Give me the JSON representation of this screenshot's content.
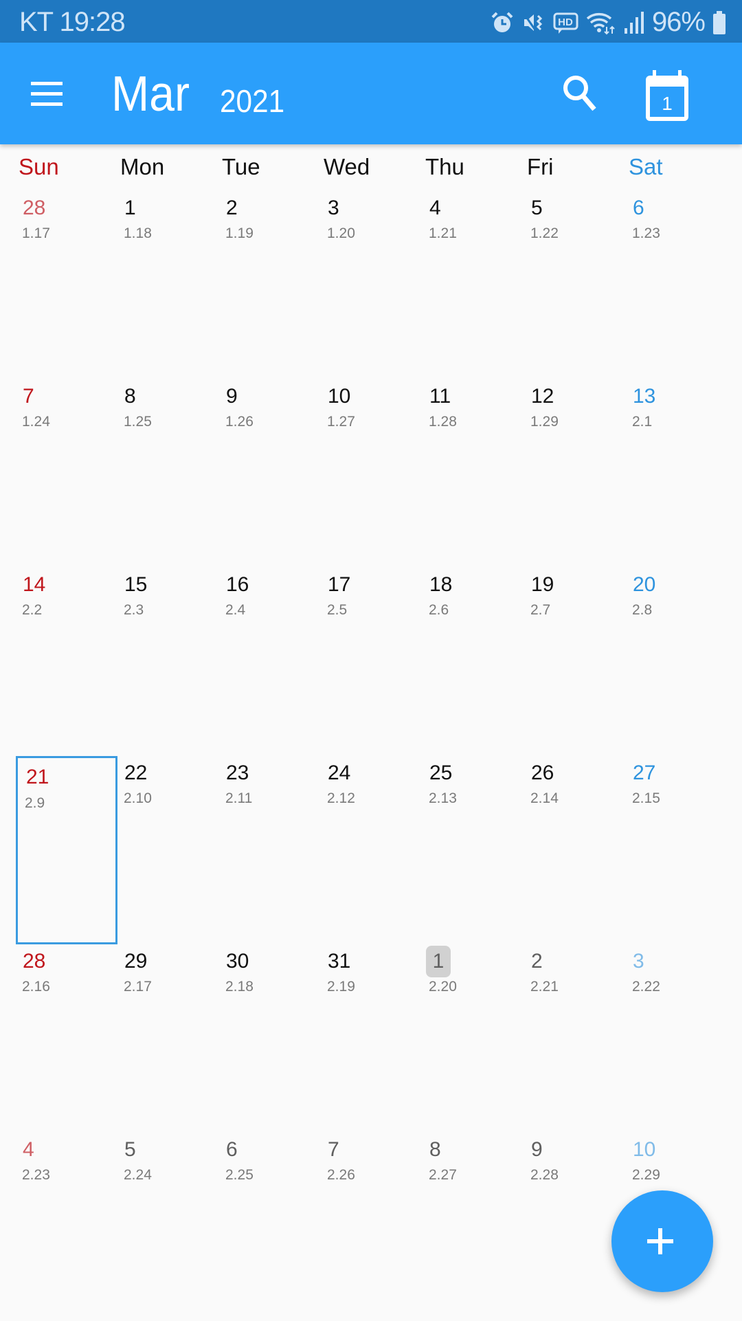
{
  "status_bar": {
    "carrier_time": "KT 19:28",
    "battery_text": "96%",
    "icons": [
      "alarm-icon",
      "vibrate-mute-icon",
      "hd-voice-icon",
      "wifi-icon",
      "signal-icon",
      "battery-icon"
    ]
  },
  "app_bar": {
    "month": "Mar",
    "year": "2021",
    "today_icon_day": "1",
    "icons": [
      "menu-icon",
      "search-icon",
      "calendar-today-icon"
    ]
  },
  "colors": {
    "app_bar": "#2b9ffb",
    "status_bar": "#1f78c1",
    "sunday": "#c0161c",
    "saturday": "#2e93de",
    "selected_border": "#3a9be0",
    "today_badge": "#cbcbcb"
  },
  "weekdays": [
    "Sun",
    "Mon",
    "Tue",
    "Wed",
    "Thu",
    "Fri",
    "Sat"
  ],
  "weeks": [
    [
      {
        "day": "28",
        "lunar": "1.17",
        "other": true
      },
      {
        "day": "1",
        "lunar": "1.18"
      },
      {
        "day": "2",
        "lunar": "1.19"
      },
      {
        "day": "3",
        "lunar": "1.20"
      },
      {
        "day": "4",
        "lunar": "1.21"
      },
      {
        "day": "5",
        "lunar": "1.22"
      },
      {
        "day": "6",
        "lunar": "1.23"
      }
    ],
    [
      {
        "day": "7",
        "lunar": "1.24"
      },
      {
        "day": "8",
        "lunar": "1.25"
      },
      {
        "day": "9",
        "lunar": "1.26"
      },
      {
        "day": "10",
        "lunar": "1.27"
      },
      {
        "day": "11",
        "lunar": "1.28"
      },
      {
        "day": "12",
        "lunar": "1.29"
      },
      {
        "day": "13",
        "lunar": "2.1"
      }
    ],
    [
      {
        "day": "14",
        "lunar": "2.2"
      },
      {
        "day": "15",
        "lunar": "2.3"
      },
      {
        "day": "16",
        "lunar": "2.4"
      },
      {
        "day": "17",
        "lunar": "2.5"
      },
      {
        "day": "18",
        "lunar": "2.6"
      },
      {
        "day": "19",
        "lunar": "2.7"
      },
      {
        "day": "20",
        "lunar": "2.8"
      }
    ],
    [
      {
        "day": "21",
        "lunar": "2.9",
        "selected": true
      },
      {
        "day": "22",
        "lunar": "2.10"
      },
      {
        "day": "23",
        "lunar": "2.11"
      },
      {
        "day": "24",
        "lunar": "2.12"
      },
      {
        "day": "25",
        "lunar": "2.13"
      },
      {
        "day": "26",
        "lunar": "2.14"
      },
      {
        "day": "27",
        "lunar": "2.15"
      }
    ],
    [
      {
        "day": "28",
        "lunar": "2.16"
      },
      {
        "day": "29",
        "lunar": "2.17"
      },
      {
        "day": "30",
        "lunar": "2.18"
      },
      {
        "day": "31",
        "lunar": "2.19"
      },
      {
        "day": "1",
        "lunar": "2.20",
        "other": true,
        "today": true
      },
      {
        "day": "2",
        "lunar": "2.21",
        "other": true
      },
      {
        "day": "3",
        "lunar": "2.22",
        "other": true
      }
    ],
    [
      {
        "day": "4",
        "lunar": "2.23",
        "other": true
      },
      {
        "day": "5",
        "lunar": "2.24",
        "other": true
      },
      {
        "day": "6",
        "lunar": "2.25",
        "other": true
      },
      {
        "day": "7",
        "lunar": "2.26",
        "other": true
      },
      {
        "day": "8",
        "lunar": "2.27",
        "other": true
      },
      {
        "day": "9",
        "lunar": "2.28",
        "other": true
      },
      {
        "day": "10",
        "lunar": "2.29",
        "other": true
      }
    ]
  ],
  "fab": {
    "icon": "plus-icon",
    "action": "add-event"
  }
}
